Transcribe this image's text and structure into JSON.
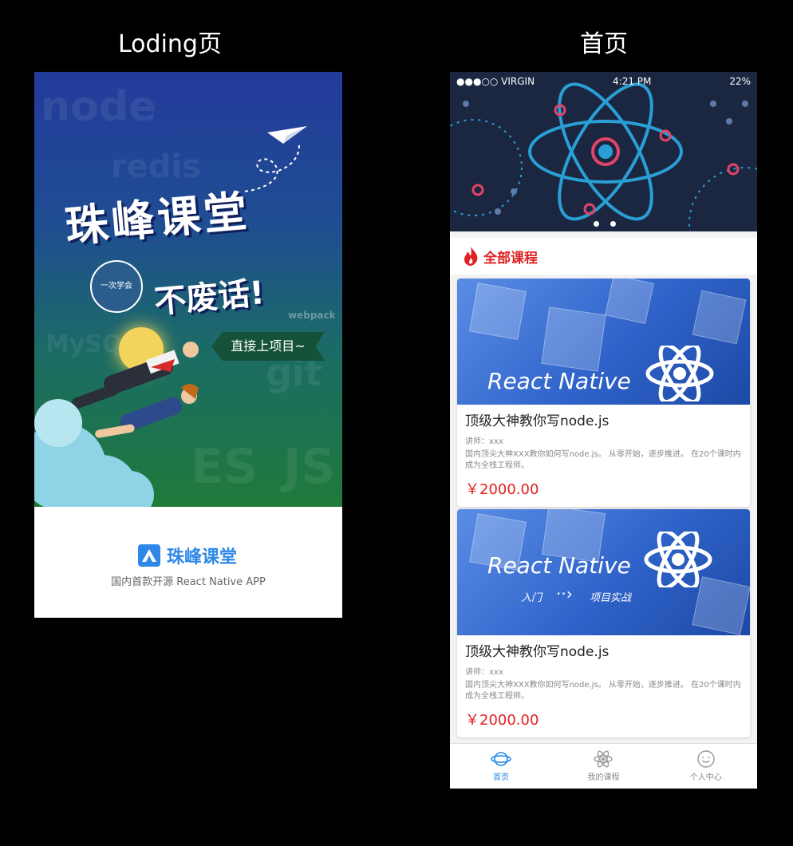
{
  "labels": {
    "loading_title": "Loding页",
    "home_title": "首页"
  },
  "loading": {
    "hero_title": "珠峰课堂",
    "hero_sub": "不废话!",
    "badge": "一次学会",
    "cta": "直接上项目~",
    "ghost_words": [
      "node",
      "redis",
      "MySQL",
      "git",
      "webpack",
      "ES",
      "JS"
    ],
    "logo_text": "珠峰课堂",
    "tagline": "国内首款开源 React  Native  APP",
    "brand_color": "#2f88e8"
  },
  "home": {
    "status": {
      "carrier": "●●●○○ VIRGIN",
      "time": "4:21 PM",
      "battery": "22%"
    },
    "section_title": "全部课程",
    "accent_color": "#e02222",
    "courses": [
      {
        "banner_text": "React Native",
        "title": "顶级大神教你写node.js",
        "teacher": "讲师：xxx",
        "desc": "国内顶尖大神XXX教你如何写node.js。 从零开始，逐步推进。 在20个课时内成为全栈工程师。",
        "price": "￥2000.00"
      },
      {
        "banner_text": "React Native",
        "banner_sub_left": "入门",
        "banner_sub_right": "项目实战",
        "title": "顶级大神教你写node.js",
        "teacher": "讲师：xxx",
        "desc": "国内顶尖大神XXX教你如何写node.js。 从零开始，逐步推进。 在20个课时内成为全栈工程师。",
        "price": "￥2000.00"
      }
    ],
    "tabs": [
      {
        "label": "首页",
        "icon": "planet-icon",
        "active": true
      },
      {
        "label": "我的课程",
        "icon": "atom-icon",
        "active": false
      },
      {
        "label": "个人中心",
        "icon": "smiley-icon",
        "active": false
      }
    ]
  }
}
